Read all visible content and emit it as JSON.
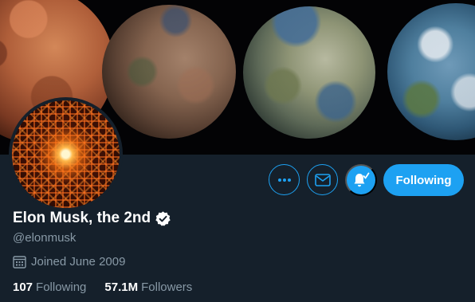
{
  "profile": {
    "display_name": "Elon Musk, the 2nd",
    "handle": "@elonmusk",
    "joined": "Joined June 2009",
    "following_count": "107",
    "following_label": "Following",
    "followers_count": "57.1M",
    "followers_label": "Followers",
    "verified_icon": "verified-badge-icon"
  },
  "actions": {
    "more_icon": "more-icon",
    "message_icon": "envelope-icon",
    "notify_icon": "bell-check-icon",
    "follow_label": "Following"
  },
  "colors": {
    "background": "#15202b",
    "accent": "#1da1f2",
    "muted_text": "#8899a6",
    "text": "#ffffff"
  }
}
